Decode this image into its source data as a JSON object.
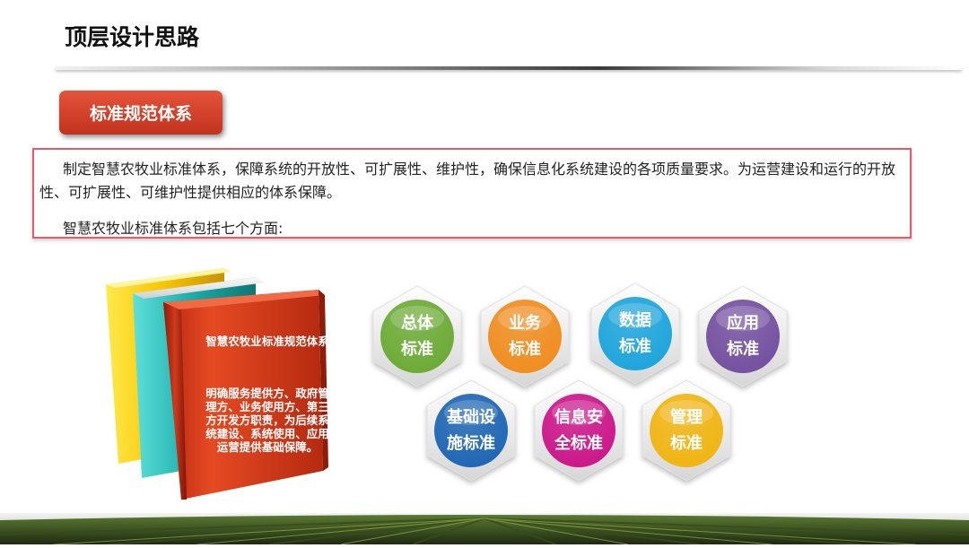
{
  "page": {
    "title": "顶层设计思路"
  },
  "tag": {
    "label": "标准规范体系"
  },
  "description": {
    "paragraph1": "制定智慧农牧业标准体系，保障系统的开放性、可扩展性、维护性，确保信息化系统建设的各项质量要求。为运营建设和运行的开放性、可扩展性、可维护性提供相应的体系保障。",
    "paragraph2": "智慧农牧业标准体系包括七个方面:"
  },
  "book": {
    "title": "智慧农牧业标准规范体系",
    "body": "明确服务提供方、政府管理方、业务使用方、第三方开发方职责，为后续系统建设、系统使用、应用运营提供基础保障。"
  },
  "standards": [
    {
      "line1": "总体",
      "line2": "标准",
      "color": "#6cab35"
    },
    {
      "line1": "业务",
      "line2": "标准",
      "color": "#f08d1f"
    },
    {
      "line1": "数据",
      "line2": "标准",
      "color": "#1da5dc"
    },
    {
      "line1": "应用",
      "line2": "标准",
      "color": "#7450a0"
    },
    {
      "line1": "基础设",
      "line2": "施标准",
      "color": "#1e66b4"
    },
    {
      "line1": "信息安",
      "line2": "全标准",
      "color": "#cc168a"
    },
    {
      "line1": "管理",
      "line2": "标准",
      "color": "#f1b512"
    }
  ]
}
